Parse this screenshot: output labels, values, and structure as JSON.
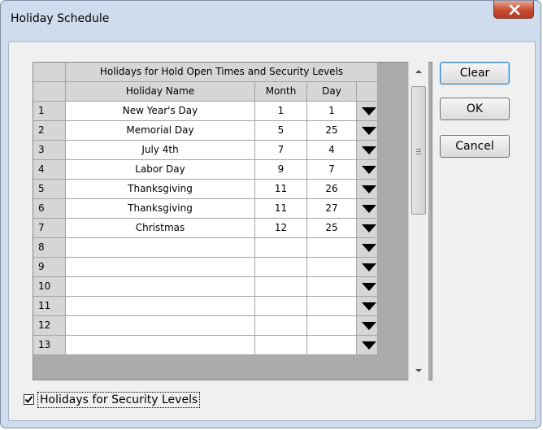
{
  "window": {
    "title": "Holiday Schedule",
    "close_glyph": "x"
  },
  "grid": {
    "caption": "Holidays for Hold Open Times and Security Levels",
    "columns": {
      "name": "Holiday Name",
      "month": "Month",
      "day": "Day"
    },
    "rows": [
      {
        "num": "1",
        "name": "New Year's Day",
        "month": "1",
        "day": "1"
      },
      {
        "num": "2",
        "name": "Memorial Day",
        "month": "5",
        "day": "25"
      },
      {
        "num": "3",
        "name": "July 4th",
        "month": "7",
        "day": "4"
      },
      {
        "num": "4",
        "name": "Labor Day",
        "month": "9",
        "day": "7"
      },
      {
        "num": "5",
        "name": "Thanksgiving",
        "month": "11",
        "day": "26"
      },
      {
        "num": "6",
        "name": "Thanksgiving",
        "month": "11",
        "day": "27"
      },
      {
        "num": "7",
        "name": "Christmas",
        "month": "12",
        "day": "25"
      },
      {
        "num": "8",
        "name": "",
        "month": "",
        "day": ""
      },
      {
        "num": "9",
        "name": "",
        "month": "",
        "day": ""
      },
      {
        "num": "10",
        "name": "",
        "month": "",
        "day": ""
      },
      {
        "num": "11",
        "name": "",
        "month": "",
        "day": ""
      },
      {
        "num": "12",
        "name": "",
        "month": "",
        "day": ""
      },
      {
        "num": "13",
        "name": "",
        "month": "",
        "day": ""
      }
    ],
    "dropdown_icon": "down-triangle-icon"
  },
  "buttons": {
    "clear": "Clear",
    "ok": "OK",
    "cancel": "Cancel"
  },
  "checkbox": {
    "label": "Holidays for Security Levels",
    "checked": true
  }
}
